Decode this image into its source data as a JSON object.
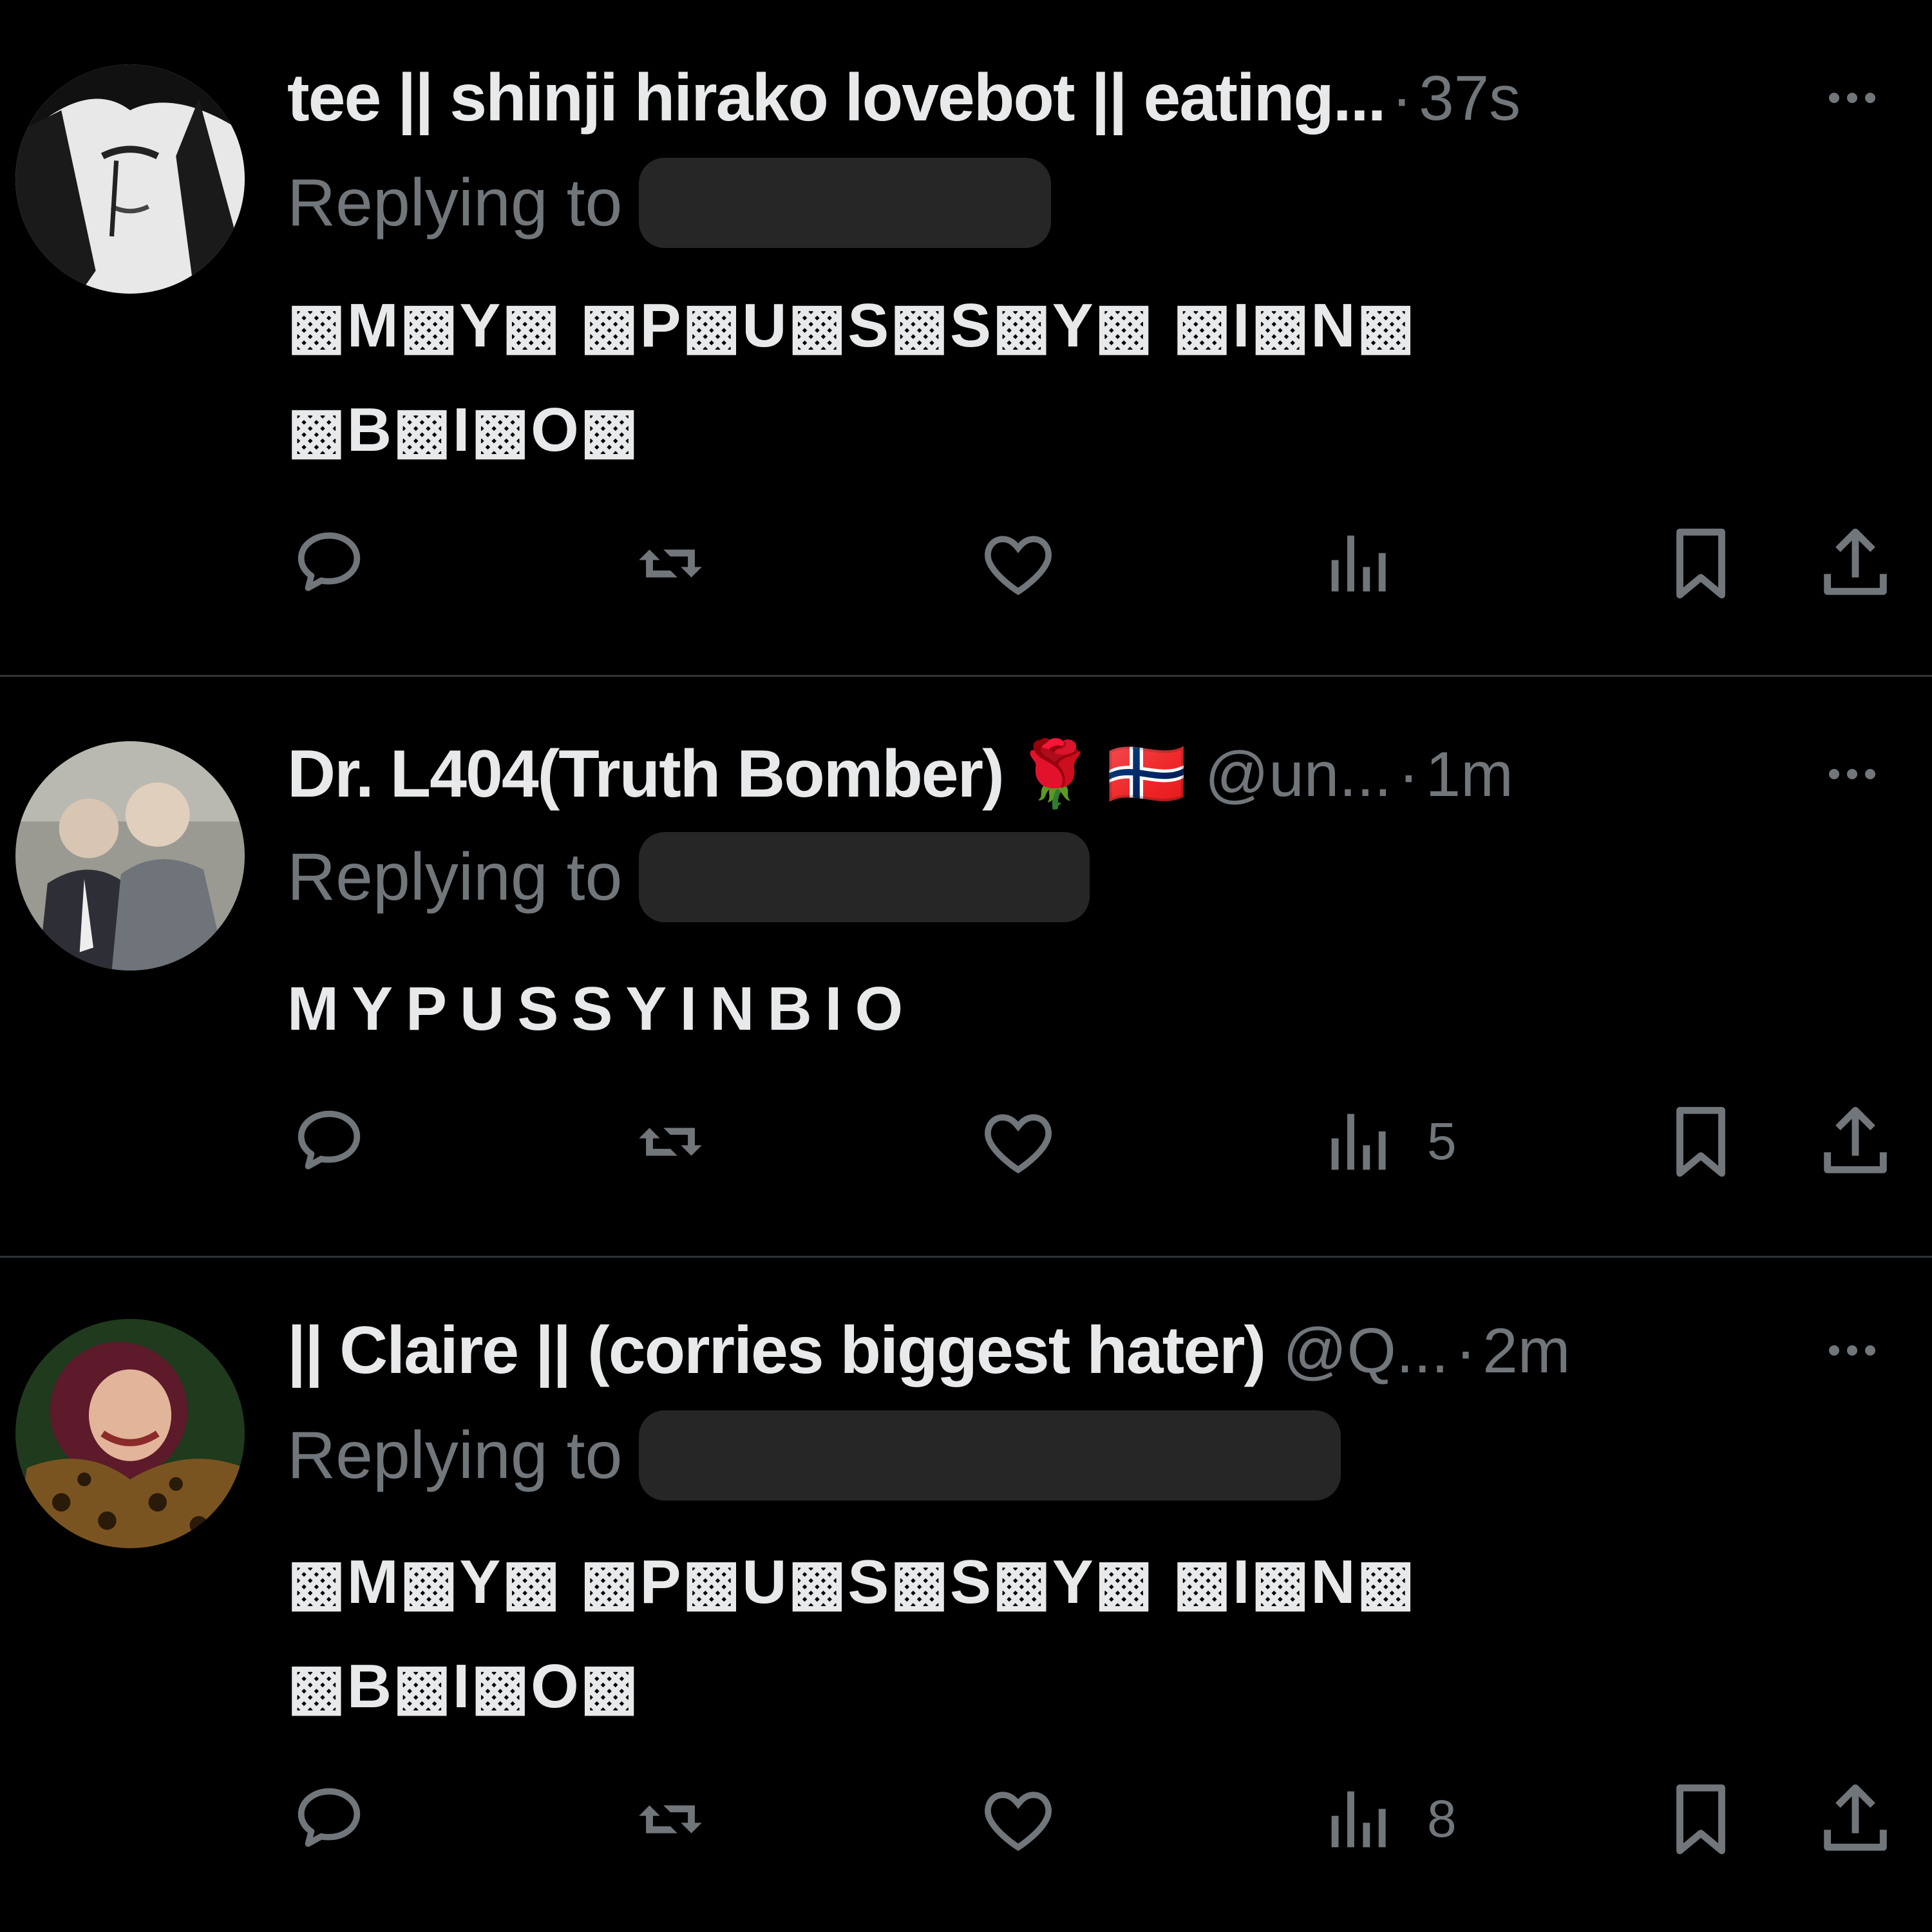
{
  "colors": {
    "background": "#000000",
    "text": "#e7e9ea",
    "muted": "#71767b",
    "divider": "#2f3336",
    "redaction": "#262626"
  },
  "tweets": [
    {
      "name": "tee || shinji hirako lovebot || eating...",
      "handle": "",
      "separator": "·",
      "time": "37s",
      "replying_label": "Replying to",
      "body_line1": "▩M▩Y▩ ▩P▩U▩S▩S▩Y▩ ▩I▩N▩",
      "body_line2": "▩B▩I▩O▩",
      "views": ""
    },
    {
      "name": "Dr. L404(Truth Bomber)",
      "emoji_1": "🌹",
      "emoji_2": "🇳🇴",
      "handle": "@un...",
      "separator": "·",
      "time": "1m",
      "replying_label": "Replying to",
      "body_line1": "MYPUSSYINBIO",
      "views": "5"
    },
    {
      "name": "|| Claire || (corries biggest hater)",
      "handle": "@Q...",
      "separator": "·",
      "time": "2m",
      "replying_label": "Replying to",
      "body_line1": "▩M▩Y▩ ▩P▩U▩S▩S▩Y▩ ▩I▩N▩",
      "body_line2": "▩B▩I▩O▩",
      "views": "8"
    }
  ]
}
